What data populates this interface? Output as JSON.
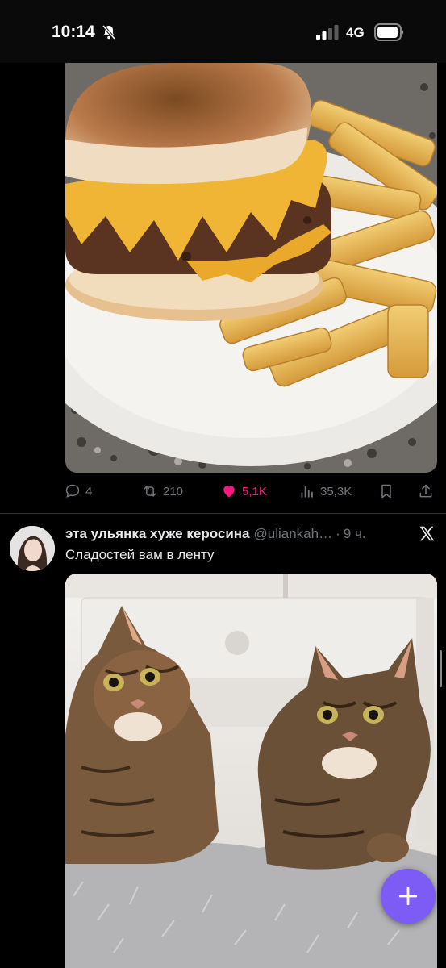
{
  "status_bar": {
    "time": "10:14",
    "network": "4G"
  },
  "tweet1": {
    "image_alt": "cheeseburger with fries",
    "stats": {
      "replies": "4",
      "reposts": "210",
      "likes": "5,1K",
      "views": "35,3K"
    }
  },
  "tweet2": {
    "author_name": "эта ульянка хуже керосина",
    "handle": "@uliankah…",
    "separator": "·",
    "time": "9 ч.",
    "text": "Сладостей вам в ленту",
    "image_alt": "two tabby cats in a bed"
  },
  "colors": {
    "accent_like": "#f91880",
    "fab": "#7c5cf5",
    "muted": "#71767b"
  },
  "icons": [
    "bell-slash-icon",
    "signal-icon",
    "battery-icon",
    "reply-icon",
    "repost-icon",
    "heart-icon",
    "views-icon",
    "bookmark-icon",
    "share-icon",
    "x-logo-icon",
    "plus-icon"
  ]
}
